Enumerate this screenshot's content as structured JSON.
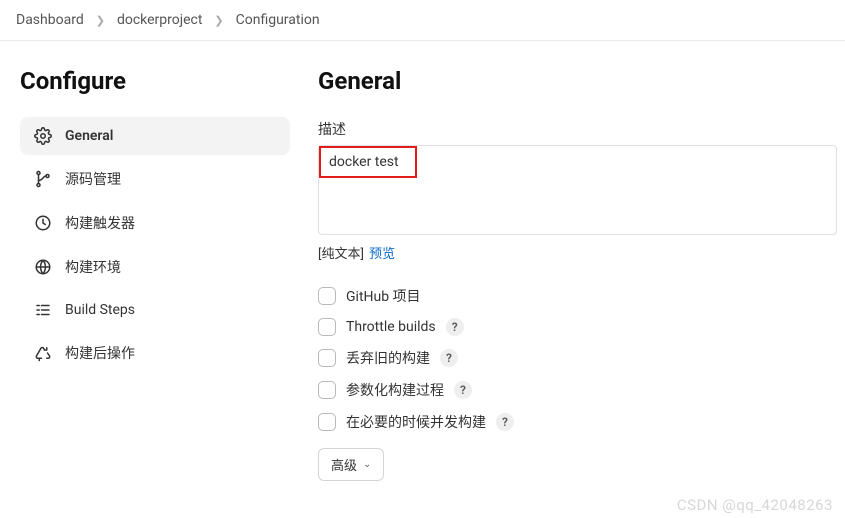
{
  "breadcrumb": {
    "items": [
      "Dashboard",
      "dockerproject",
      "Configuration"
    ]
  },
  "sidebar": {
    "title": "Configure",
    "items": [
      {
        "label": "General"
      },
      {
        "label": "源码管理"
      },
      {
        "label": "构建触发器"
      },
      {
        "label": "构建环境"
      },
      {
        "label": "Build Steps"
      },
      {
        "label": "构建后操作"
      }
    ]
  },
  "main": {
    "title": "General",
    "description_label": "描述",
    "description_value": "docker test",
    "plain_text_label": "[纯文本]",
    "preview_label": "预览",
    "options": [
      {
        "label": "GitHub 项目",
        "help": false
      },
      {
        "label": "Throttle builds",
        "help": true
      },
      {
        "label": "丢弃旧的构建",
        "help": true
      },
      {
        "label": "参数化构建过程",
        "help": true
      },
      {
        "label": "在必要的时候并发构建",
        "help": true
      }
    ],
    "advanced_label": "高级"
  },
  "watermark": "CSDN @qq_42048263"
}
